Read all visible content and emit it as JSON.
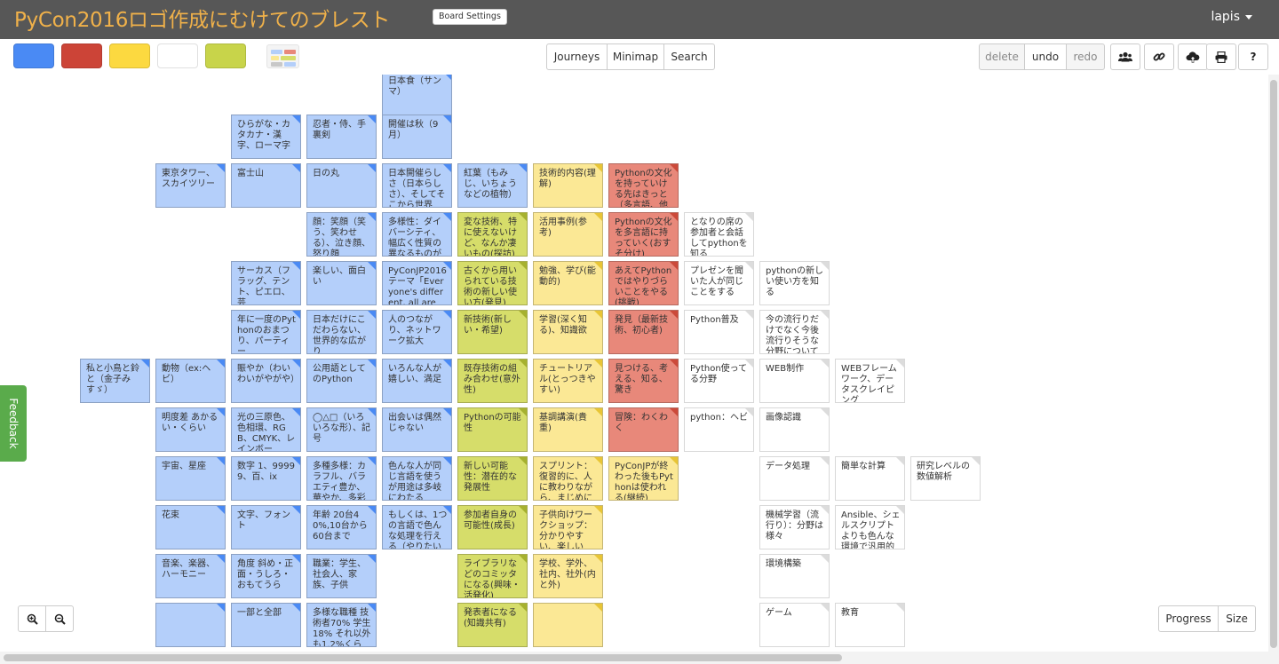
{
  "header": {
    "title": "PyCon2016ロゴ作成にむけてのブレスト",
    "board_settings_label": "Board Settings",
    "user_name": "lapis"
  },
  "toolbar": {
    "colors": [
      "#4a8af4",
      "#cc4437",
      "#fcd940",
      "#ffffff",
      "#c8d44a"
    ],
    "view_buttons": [
      "Journeys",
      "Minimap",
      "Search"
    ],
    "history": {
      "delete": "delete",
      "undo": "undo",
      "redo": "redo"
    },
    "icons": [
      "users-icon",
      "link-icon",
      "cloud-upload-icon",
      "print-icon",
      "help-icon"
    ],
    "help_label": "?"
  },
  "feedback_label": "Feedback",
  "bottom": {
    "progress_label": "Progress",
    "size_label": "Size"
  },
  "cards": [
    {
      "color": "blue",
      "text": "日本食（サンマ）"
    },
    {
      "color": "blue",
      "text": "ひらがな・カタカナ・漢字、ローマ字"
    },
    {
      "color": "blue",
      "text": "忍者・侍、手裏剣"
    },
    {
      "color": "blue",
      "text": "開催は秋（9月）"
    },
    {
      "color": "blue",
      "text": "東京タワー、スカイツリー"
    },
    {
      "color": "blue",
      "text": "富士山"
    },
    {
      "color": "blue",
      "text": "日の丸"
    },
    {
      "color": "blue",
      "text": "日本開催らしさ（日本らしさ）、そしてそこから世界"
    },
    {
      "color": "blue",
      "text": "紅葉（もみじ、いちょうなどの植物）"
    },
    {
      "color": "yellow",
      "text": "技術的内容(理解)"
    },
    {
      "color": "red",
      "text": "Pythonの文化を持っていける先はきっと（多言語、他"
    },
    {
      "color": "blue",
      "text": "顔：笑顔（笑う、笑わせる）、泣き顔、怒り顔"
    },
    {
      "color": "blue",
      "text": "多様性：ダイバーシティ、幅広く性質の異なるものが"
    },
    {
      "color": "olive",
      "text": "変な技術、特に使えないけど、なんか凄いもの(探訪)"
    },
    {
      "color": "yellow",
      "text": "活用事例(参考)"
    },
    {
      "color": "red",
      "text": "Pythonの文化を多言語に持っていく(おすそ分け)"
    },
    {
      "color": "white",
      "text": "となりの席の参加者と会話してpythonを知る"
    },
    {
      "color": "blue",
      "text": "サーカス（フラッグ、テント、ピエロ、芸"
    },
    {
      "color": "blue",
      "text": "楽しい、面白い"
    },
    {
      "color": "blue",
      "text": "PyConJP2016テーマ「Everyone's different, all are"
    },
    {
      "color": "olive",
      "text": "古くから用いられている技術の新しい使い方(発見)"
    },
    {
      "color": "yellow",
      "text": "勉強、学び(能動的)"
    },
    {
      "color": "red",
      "text": "あえてPythonではやりづらいことをやる(挑戦)"
    },
    {
      "color": "white",
      "text": "プレゼンを聞いた人が同じことをする"
    },
    {
      "color": "white",
      "text": "pythonの新しい使い方を知る"
    },
    {
      "color": "blue",
      "text": "年に一度のPythonのおまつり、パーティー"
    },
    {
      "color": "blue",
      "text": "日本だけにこだわらない、世界的な広がり"
    },
    {
      "color": "blue",
      "text": "人のつながり、ネットワーク拡大"
    },
    {
      "color": "olive",
      "text": "新技術(新しい・希望)"
    },
    {
      "color": "yellow",
      "text": "学習(深く知る)、知識欲"
    },
    {
      "color": "red",
      "text": "発見（最新技術、初心者)"
    },
    {
      "color": "white",
      "text": "Python普及"
    },
    {
      "color": "white",
      "text": "今の流行りだけでなく今後流行りそうな分野について"
    },
    {
      "color": "blue",
      "text": "私と小鳥と鈴と（金子みすゞ）"
    },
    {
      "color": "blue",
      "text": "動物（ex:ヘビ）"
    },
    {
      "color": "blue",
      "text": "賑やか（わいわいがやがや）"
    },
    {
      "color": "blue",
      "text": "公用語としてのPython"
    },
    {
      "color": "blue",
      "text": "いろんな人が嬉しい、満足"
    },
    {
      "color": "olive",
      "text": "既存技術の組み合わせ(意外性)"
    },
    {
      "color": "yellow",
      "text": "チュートリアル(とっつきやすい)"
    },
    {
      "color": "red",
      "text": "見つける、考える、知る、驚き"
    },
    {
      "color": "white",
      "text": "Python使ってる分野"
    },
    {
      "color": "white",
      "text": "WEB制作"
    },
    {
      "color": "white",
      "text": "WEBフレームワーク、データスクレイピング"
    },
    {
      "color": "blue",
      "text": "明度差 あかるい・くらい"
    },
    {
      "color": "blue",
      "text": "光の三原色、色相環、RGB、CMYK、レインボー"
    },
    {
      "color": "blue",
      "text": "◯△□（いろいろな形）、記号"
    },
    {
      "color": "blue",
      "text": "出会いは偶然じゃない"
    },
    {
      "color": "olive",
      "text": "Pythonの可能性"
    },
    {
      "color": "yellow",
      "text": "基調講演(貴重)"
    },
    {
      "color": "red",
      "text": "冒険：わくわく"
    },
    {
      "color": "white",
      "text": "python：ヘビ"
    },
    {
      "color": "white",
      "text": "画像認識"
    },
    {
      "color": "blue",
      "text": "宇宙、星座"
    },
    {
      "color": "blue",
      "text": "数字 1、99999、百、ix"
    },
    {
      "color": "blue",
      "text": "多種多様：カラフル、バラエティ豊か、華やか、多彩"
    },
    {
      "color": "blue",
      "text": "色んな人が同じ言語を使うが用途は多岐にわたる"
    },
    {
      "color": "olive",
      "text": "新しい可能性：潜在的な発展性"
    },
    {
      "color": "yellow",
      "text": "スプリント：復習的に、人に教わりながら、まじめに"
    },
    {
      "color": "yellow",
      "text": "PyConJPが終わった後もPythonは使われる(継続)"
    },
    {
      "color": "white",
      "text": "データ処理"
    },
    {
      "color": "white",
      "text": "簡単な計算"
    },
    {
      "color": "white",
      "text": "研究レベルの数値解析"
    },
    {
      "color": "blue",
      "text": "花束"
    },
    {
      "color": "blue",
      "text": "文字、フォント"
    },
    {
      "color": "blue",
      "text": "年齢 20台40%,10台から60台まで"
    },
    {
      "color": "blue",
      "text": "もしくは、1つの言語で色んな処理を行える（やりたい"
    },
    {
      "color": "olive",
      "text": "参加者自身の可能性(成長)"
    },
    {
      "color": "yellow",
      "text": "子供向けワークショップ：分かりやすい、楽しい"
    },
    {
      "color": "white",
      "text": "機械学習（流行り）：分野は様々"
    },
    {
      "color": "white",
      "text": "Ansible、シェルスクリプトよりも色んな環境で汎用的"
    },
    {
      "color": "blue",
      "text": "音楽、楽器、ハーモニー"
    },
    {
      "color": "blue",
      "text": "角度 斜め・正面・うしろ・おもてうら"
    },
    {
      "color": "blue",
      "text": "職業：学生、社会人、家族、子供"
    },
    {
      "color": "olive",
      "text": "ライブラリなどのコミッタになる(興味・活発化)"
    },
    {
      "color": "yellow",
      "text": "学校、学外、社内、社外(内と外)"
    },
    {
      "color": "white",
      "text": "環境構築"
    },
    {
      "color": "blue",
      "text": "一部と全部"
    },
    {
      "color": "blue",
      "text": "多様な職種 技術者70% 学生18% それ以外も1.2%くら"
    },
    {
      "color": "olive",
      "text": "発表者になる(知識共有)"
    },
    {
      "color": "white",
      "text": "ゲーム"
    },
    {
      "color": "white",
      "text": "教育"
    }
  ]
}
